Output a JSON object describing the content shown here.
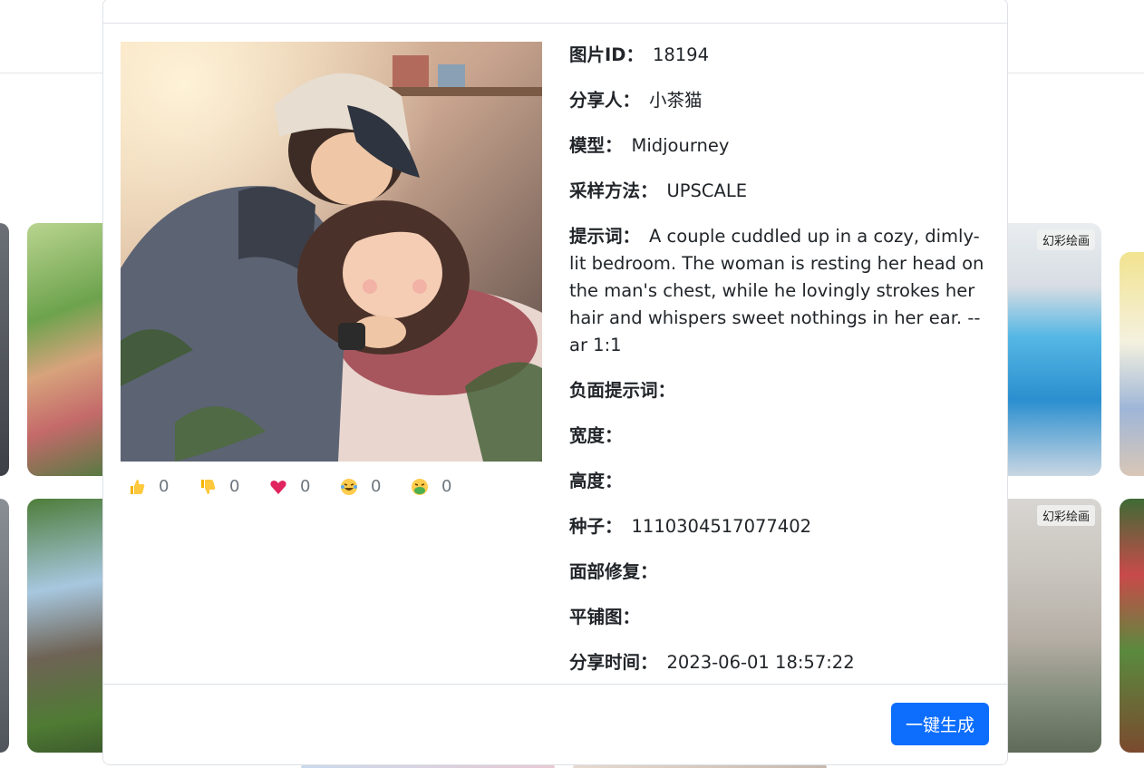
{
  "background": {
    "cards": [
      {
        "badge": ""
      },
      {
        "badge": ""
      },
      {
        "badge": "幻彩绘画"
      },
      {
        "badge": ""
      },
      {
        "badge": ""
      },
      {
        "badge": ""
      },
      {
        "badge": "幻彩绘画"
      },
      {
        "badge": ""
      }
    ]
  },
  "modal": {
    "reactions": [
      {
        "icon": "thumbs-up-icon",
        "count": "0"
      },
      {
        "icon": "thumbs-down-icon",
        "count": "0"
      },
      {
        "icon": "heart-icon",
        "count": "0"
      },
      {
        "icon": "laughing-icon",
        "count": "0"
      },
      {
        "icon": "nauseated-icon",
        "count": "0"
      }
    ],
    "details": {
      "image_id": {
        "label": "图片ID：",
        "value": "18194"
      },
      "sharer": {
        "label": "分享人：",
        "value": "小茶猫"
      },
      "model": {
        "label": "模型：",
        "value": "Midjourney"
      },
      "sampler": {
        "label": "采样方法：",
        "value": "UPSCALE"
      },
      "prompt": {
        "label": "提示词：",
        "value": "A couple cuddled up in a cozy, dimly-lit bedroom. The woman is resting her head on the man's chest, while he lovingly strokes her hair and whispers sweet nothings in her ear. --ar 1:1"
      },
      "negative_prompt": {
        "label": "负面提示词：",
        "value": ""
      },
      "width": {
        "label": "宽度：",
        "value": ""
      },
      "height": {
        "label": "高度：",
        "value": ""
      },
      "seed": {
        "label": "种子：",
        "value": "1110304517077402"
      },
      "face_restore": {
        "label": "面部修复：",
        "value": ""
      },
      "tiling": {
        "label": "平铺图：",
        "value": ""
      },
      "share_time": {
        "label": "分享时间：",
        "value": "2023-06-01 18:57:22"
      }
    },
    "generate_button": "一键生成"
  },
  "colors": {
    "primary": "#0d6efd",
    "heart": "#e0245e"
  }
}
